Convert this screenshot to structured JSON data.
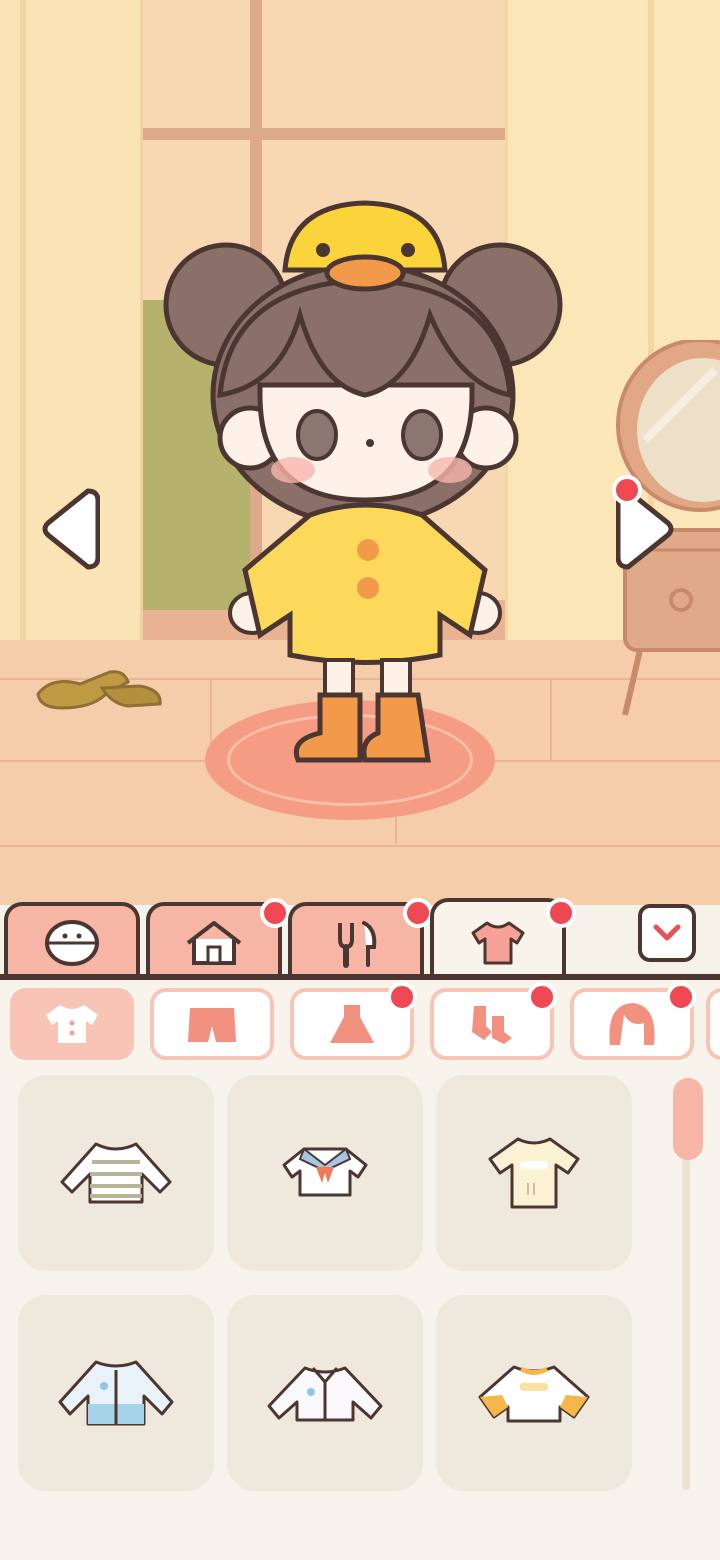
{
  "scene": {
    "nav": {
      "prev": "previous-outfit",
      "next": "next-outfit"
    },
    "character": {
      "hat": "duck-hat",
      "top": "yellow-raincoat",
      "shoes": "orange-boots"
    }
  },
  "tabs": [
    {
      "icon": "face-icon",
      "active": false,
      "badge": false
    },
    {
      "icon": "house-icon",
      "active": false,
      "badge": true
    },
    {
      "icon": "food-icon",
      "active": false,
      "badge": true
    },
    {
      "icon": "shirt-icon",
      "active": true,
      "badge": true
    }
  ],
  "subtabs": [
    {
      "icon": "top-icon",
      "active": true,
      "badge": false
    },
    {
      "icon": "pants-icon",
      "active": false,
      "badge": false
    },
    {
      "icon": "dress-icon",
      "active": false,
      "badge": true
    },
    {
      "icon": "socks-icon",
      "active": false,
      "badge": true
    },
    {
      "icon": "hair-icon",
      "active": false,
      "badge": true
    }
  ],
  "items": [
    {
      "name": "striped-longsleeve"
    },
    {
      "name": "sailor-top"
    },
    {
      "name": "cream-tshirt"
    },
    {
      "name": "blue-open-shirt"
    },
    {
      "name": "white-jacket"
    },
    {
      "name": "white-orange-sweatshirt"
    }
  ],
  "colors": {
    "outline": "#4b3631",
    "accent": "#f6b5a5",
    "badge": "#ee4852"
  }
}
